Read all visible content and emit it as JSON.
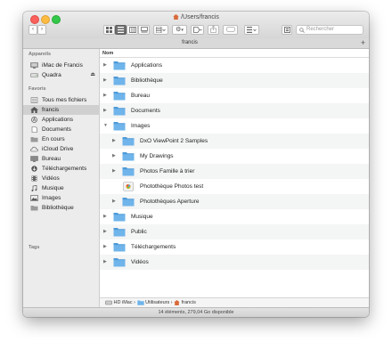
{
  "window": {
    "title": "/Users/francis",
    "tab": "francis",
    "search_placeholder": "Rechercher"
  },
  "sidebar": {
    "sections": [
      "Appareils",
      "Favoris",
      "Tags"
    ],
    "devices": [
      {
        "label": "iMac de Francis",
        "icon": "imac-icon"
      },
      {
        "label": "Quadra",
        "icon": "network-drive-icon"
      }
    ],
    "favorites": [
      {
        "label": "Tous mes fichiers",
        "icon": "all-files-icon"
      },
      {
        "label": "francis",
        "icon": "home-icon"
      },
      {
        "label": "Applications",
        "icon": "applications-icon"
      },
      {
        "label": "Documents",
        "icon": "documents-icon"
      },
      {
        "label": "En cours",
        "icon": "folder-icon"
      },
      {
        "label": "iCloud Drive",
        "icon": "cloud-icon"
      },
      {
        "label": "Bureau",
        "icon": "desktop-icon"
      },
      {
        "label": "Téléchargements",
        "icon": "downloads-icon"
      },
      {
        "label": "Vidéos",
        "icon": "movies-icon"
      },
      {
        "label": "Musique",
        "icon": "music-icon"
      },
      {
        "label": "Images",
        "icon": "pictures-icon"
      },
      {
        "label": "Bibliothèque",
        "icon": "folder-icon"
      }
    ]
  },
  "list": {
    "column_header": "Nom",
    "rows": [
      {
        "label": "Applications",
        "level": 0,
        "expanded": false
      },
      {
        "label": "Bibliothèque",
        "level": 0,
        "expanded": false
      },
      {
        "label": "Bureau",
        "level": 0,
        "expanded": false
      },
      {
        "label": "Documents",
        "level": 0,
        "expanded": false
      },
      {
        "label": "Images",
        "level": 0,
        "expanded": true
      },
      {
        "label": "DxO ViewPoint 2 Samples",
        "level": 1,
        "expanded": false
      },
      {
        "label": "My Drawings",
        "level": 1,
        "expanded": false
      },
      {
        "label": "Photos Famille à trier",
        "level": 1,
        "expanded": false
      },
      {
        "label": "Photothèque Photos test",
        "level": 1,
        "expanded": null
      },
      {
        "label": "Photothèques Aperture",
        "level": 1,
        "expanded": false
      },
      {
        "label": "Musique",
        "level": 0,
        "expanded": false
      },
      {
        "label": "Public",
        "level": 0,
        "expanded": false
      },
      {
        "label": "Téléchargements",
        "level": 0,
        "expanded": false
      },
      {
        "label": "Vidéos",
        "level": 0,
        "expanded": false
      }
    ]
  },
  "pathbar": {
    "items": [
      "HD iMac",
      "Utilisateurs",
      "francis"
    ],
    "separator": "›"
  },
  "status": "14 éléments, 279,04 Go disponible",
  "colors": {
    "folder": "#6fb4ea",
    "folder_dark": "#4c9ad8",
    "selected_sidebar": "#d0d0d0"
  }
}
